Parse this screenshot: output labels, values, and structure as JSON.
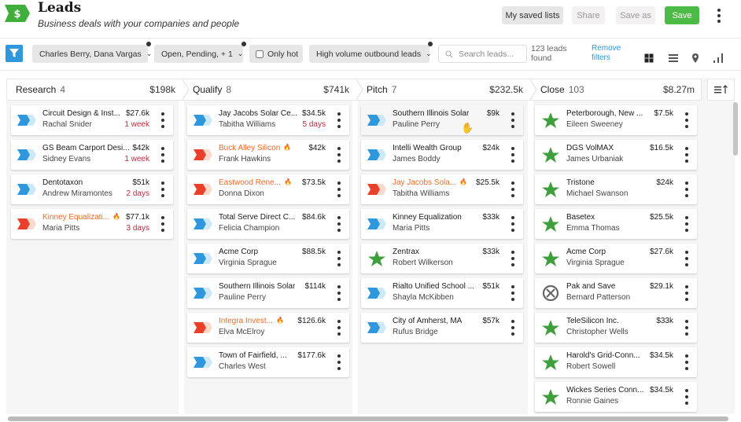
{
  "header": {
    "title": "Leads",
    "subtitle": "Business deals with your companies and people",
    "logo_icon": "dollar-sign-icon",
    "buttons": {
      "my_saved_lists": "My saved lists",
      "share": "Share",
      "save_as": "Save as",
      "save": "Save"
    },
    "more_icon": "vertical-ellipsis-icon"
  },
  "colors": {
    "brand_green": "#4cba46",
    "accent_blue": "#2f97dc",
    "hot_orange": "#ee6a27",
    "hot_red": "#e8402b",
    "overdue_red": "#c0263d",
    "won_green": "#3f9f3b",
    "lost_gray": "#666666"
  },
  "filters": {
    "filter_icon": "funnel-icon",
    "owners": "Charles Berry, Dana Vargas",
    "status": "Open, Pending, + 1",
    "only_hot_label": "Only hot",
    "only_hot_checked": false,
    "saved_view": "High volume outbound leads",
    "search_placeholder": "Search leads...",
    "search_value": "",
    "results_count": "123 leads found",
    "remove_filters": "Remove filters",
    "views": [
      {
        "name": "board",
        "icon": "grid-icon",
        "active": true
      },
      {
        "name": "list",
        "icon": "list-icon",
        "active": false
      },
      {
        "name": "map",
        "icon": "map-pin-icon",
        "active": false
      },
      {
        "name": "report",
        "icon": "bar-chart-icon",
        "active": false
      }
    ]
  },
  "board": {
    "sort_icon": "sort-ascending-icon",
    "stages": [
      {
        "name": "Research",
        "count": "4",
        "total": "$198k",
        "cards": [
          {
            "company": "Circuit Design & Inst...",
            "person": "Rachal Snider",
            "amount": "$27.6k",
            "due": "1 week",
            "hot": false,
            "status": "open"
          },
          {
            "company": "GS Beam Carport Desi...",
            "person": "Sidney Evans",
            "amount": "$42k",
            "due": "1 week",
            "hot": false,
            "status": "open"
          },
          {
            "company": "Dentotaxon",
            "person": "Andrew Miramontes",
            "amount": "$51k",
            "due": "2 days",
            "hot": false,
            "status": "open"
          },
          {
            "company": "Kinney Equalizati...",
            "person": "Maria Pitts",
            "amount": "$77.1k",
            "due": "3 days",
            "hot": true,
            "status": "open"
          }
        ]
      },
      {
        "name": "Qualify",
        "count": "8",
        "total": "$741k",
        "cards": [
          {
            "company": "Jay Jacobs Solar Ce...",
            "person": "Tabitha Williams",
            "amount": "$34.5k",
            "due": "5 days",
            "hot": false,
            "status": "open"
          },
          {
            "company": "Buck Alley Silicon",
            "person": "Frank Hawkins",
            "amount": "$42k",
            "due": "",
            "hot": true,
            "status": "open"
          },
          {
            "company": "Eastwood Rene...",
            "person": "Donna Dixon",
            "amount": "$73.5k",
            "due": "",
            "hot": true,
            "status": "open"
          },
          {
            "company": "Total Serve Direct C...",
            "person": "Felicia Champion",
            "amount": "$84.6k",
            "due": "",
            "hot": false,
            "status": "open"
          },
          {
            "company": "Acme Corp",
            "person": "Virginia Sprague",
            "amount": "$88.5k",
            "due": "",
            "hot": false,
            "status": "open"
          },
          {
            "company": "Southern Illinois Solar",
            "person": "Pauline Perry",
            "amount": "$114k",
            "due": "",
            "hot": false,
            "status": "open"
          },
          {
            "company": "Integra Invest...",
            "person": "Elva McElroy",
            "amount": "$126.6k",
            "due": "",
            "hot": true,
            "status": "open"
          },
          {
            "company": "Town of Fairfield, ...",
            "person": "Charles West",
            "amount": "$177.6k",
            "due": "",
            "hot": false,
            "status": "open"
          }
        ]
      },
      {
        "name": "Pitch",
        "count": "7",
        "total": "$232.5k",
        "cards": [
          {
            "company": "Southern Illinois Solar",
            "person": "Pauline Perry",
            "amount": "$9k",
            "due": "",
            "hot": false,
            "status": "open"
          },
          {
            "company": "Intelli Wealth Group",
            "person": "James Boddy",
            "amount": "$24k",
            "due": "",
            "hot": false,
            "status": "open"
          },
          {
            "company": "Jay Jacobs Sola...",
            "person": "Tabitha Williams",
            "amount": "$25.5k",
            "due": "",
            "hot": true,
            "status": "open"
          },
          {
            "company": "Kinney Equalization",
            "person": "Maria Pitts",
            "amount": "$33k",
            "due": "",
            "hot": false,
            "status": "open"
          },
          {
            "company": "Zentrax",
            "person": "Robert Wilkerson",
            "amount": "$33k",
            "due": "",
            "hot": false,
            "status": "won"
          },
          {
            "company": "Rialto Unified School ...",
            "person": "Shayla McKibben",
            "amount": "$51k",
            "due": "",
            "hot": false,
            "status": "open"
          },
          {
            "company": "City of Amherst, MA",
            "person": "Rufus Bridge",
            "amount": "$57k",
            "due": "",
            "hot": false,
            "status": "open"
          }
        ]
      },
      {
        "name": "Close",
        "count": "103",
        "total": "$8.27m",
        "cards": [
          {
            "company": "Peterborough, New ...",
            "person": "Eileen Sweeney",
            "amount": "$7.5k",
            "due": "",
            "hot": false,
            "status": "won"
          },
          {
            "company": "DGS VolMAX",
            "person": "James Urbaniak",
            "amount": "$16.5k",
            "due": "",
            "hot": false,
            "status": "won"
          },
          {
            "company": "Tristone",
            "person": "Michael Swanson",
            "amount": "$24k",
            "due": "",
            "hot": false,
            "status": "won"
          },
          {
            "company": "Basetex",
            "person": "Emma Thomas",
            "amount": "$25.5k",
            "due": "",
            "hot": false,
            "status": "won"
          },
          {
            "company": "Acme Corp",
            "person": "Virginia Sprague",
            "amount": "$27.6k",
            "due": "",
            "hot": false,
            "status": "won"
          },
          {
            "company": "Pak and Save",
            "person": "Bernard Patterson",
            "amount": "$29.1k",
            "due": "",
            "hot": false,
            "status": "lost"
          },
          {
            "company": "TeleSilicon Inc.",
            "person": "Christopher Wells",
            "amount": "$33k",
            "due": "",
            "hot": false,
            "status": "won"
          },
          {
            "company": "Harold's Grid-Conn...",
            "person": "Robert Sowell",
            "amount": "$34.5k",
            "due": "",
            "hot": false,
            "status": "won"
          },
          {
            "company": "Wickes Series Conn...",
            "person": "Ronnie Gaines",
            "amount": "$34.5k",
            "due": "",
            "hot": false,
            "status": "won"
          }
        ]
      }
    ]
  }
}
